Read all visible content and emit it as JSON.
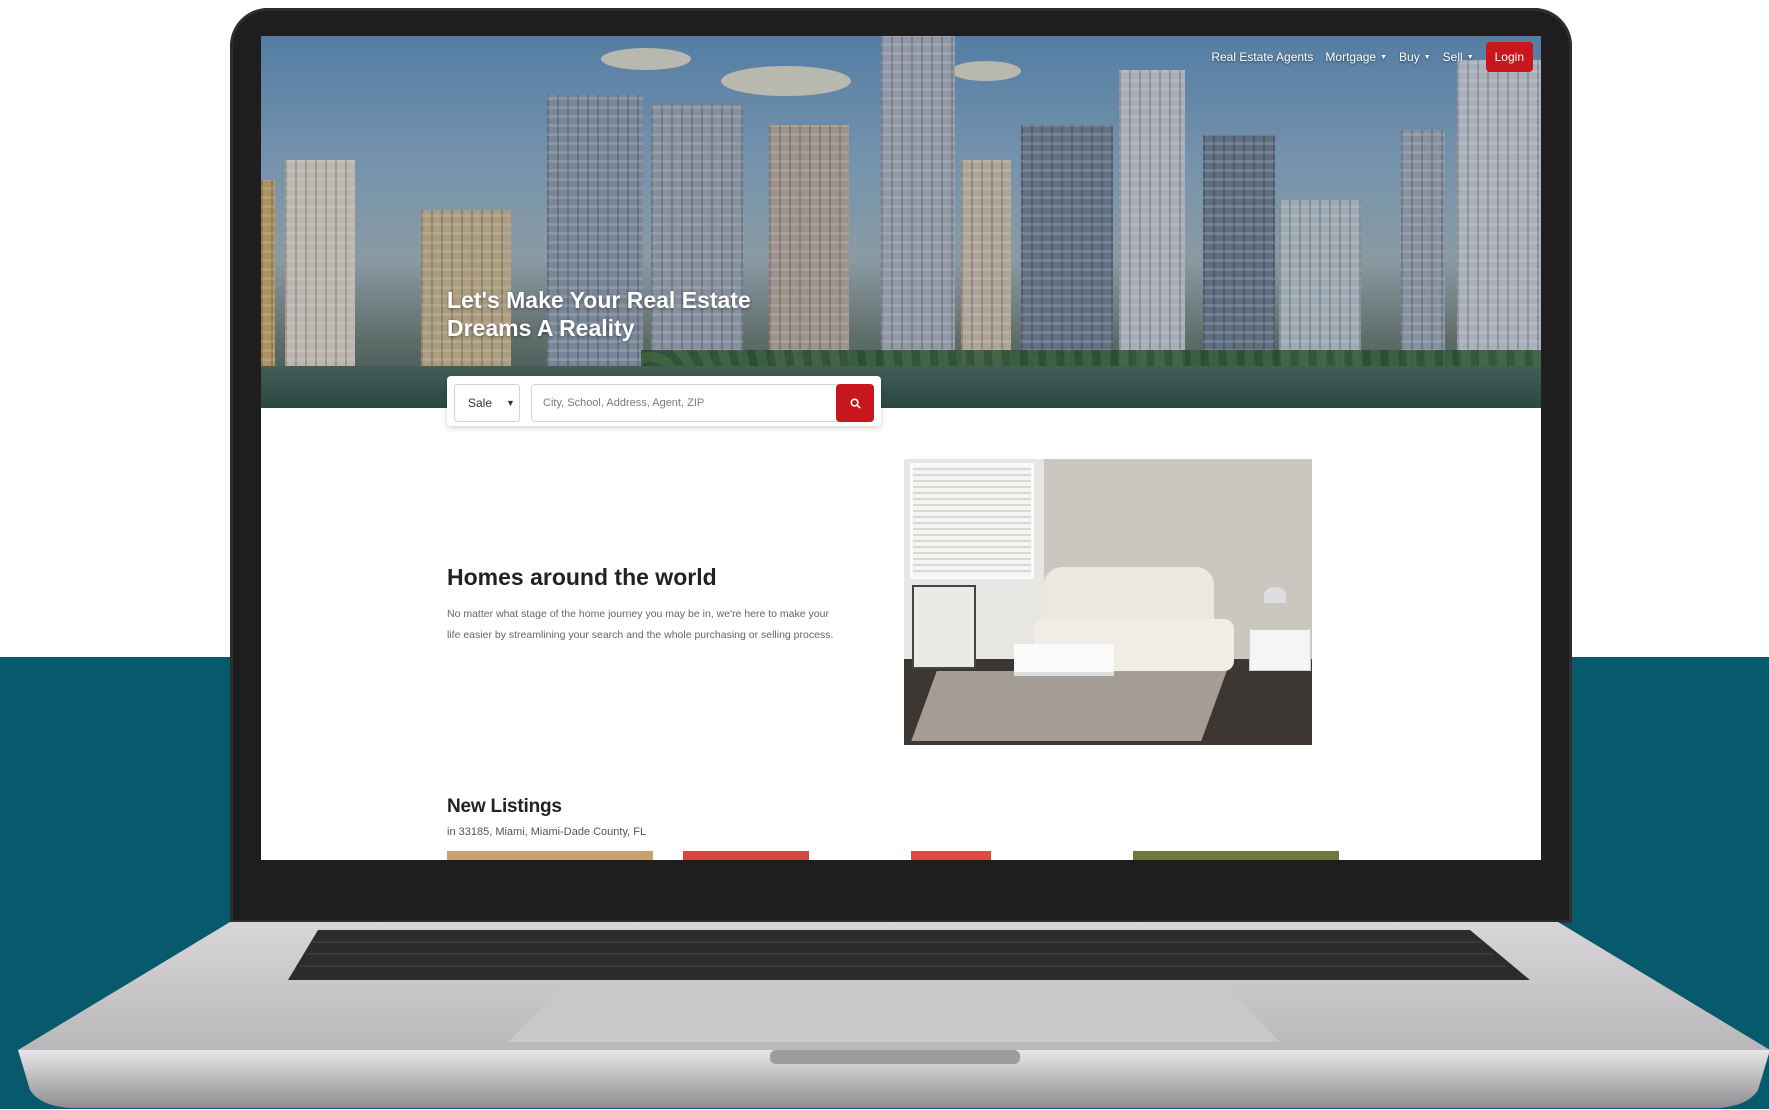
{
  "nav": {
    "items": [
      {
        "label": "Real Estate Agents",
        "dropdown": false
      },
      {
        "label": "Mortgage",
        "dropdown": true
      },
      {
        "label": "Buy",
        "dropdown": true
      },
      {
        "label": "Sell",
        "dropdown": true
      }
    ],
    "login_label": "Login"
  },
  "hero": {
    "title_line1": "Let's Make Your Real Estate",
    "title_line2": "Dreams A Reality"
  },
  "search": {
    "type_value": "Sale",
    "placeholder": "City, School, Address, Agent, ZIP"
  },
  "homes": {
    "title": "Homes around the world",
    "description_line1": "No matter what stage of the home journey you may be in, we're here to make your",
    "description_line2": "life easier by streamlining your search and the whole purchasing or selling process."
  },
  "listings": {
    "title": "New Listings",
    "subtitle": "in 33185, Miami, Miami-Dade County, FL"
  },
  "colors": {
    "accent": "#c8161d",
    "teal_background": "#075a6b",
    "laptop_bezel": "#1f1d1e"
  }
}
